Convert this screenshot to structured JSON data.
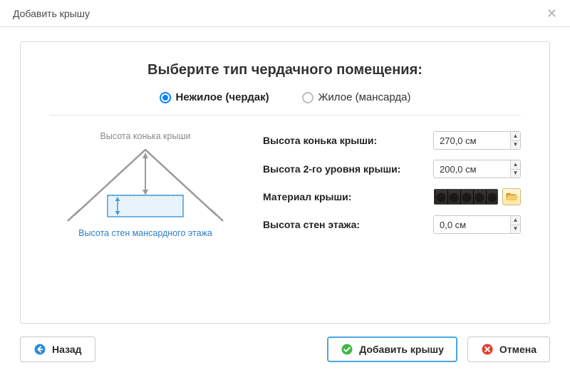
{
  "window": {
    "title": "Добавить крышу"
  },
  "heading": "Выберите тип чердачного помещения:",
  "attic_type": {
    "options": [
      {
        "label": "Нежилое (чердак)",
        "selected": true
      },
      {
        "label": "Жилое (мансарда)",
        "selected": false
      }
    ]
  },
  "diagram": {
    "top_caption": "Высота конька крыши",
    "bottom_caption": "Высота стен мансардного этажа"
  },
  "fields": {
    "ridge_height": {
      "label": "Высота конька крыши:",
      "value": "270,0 см"
    },
    "level2_height": {
      "label": "Высота 2-го уровня крыши:",
      "value": "200,0 см"
    },
    "material": {
      "label": "Материал крыши:"
    },
    "wall_height": {
      "label": "Высота стен этажа:",
      "value": "0,0 см"
    }
  },
  "buttons": {
    "back": "Назад",
    "add": "Добавить крышу",
    "cancel": "Отмена"
  }
}
